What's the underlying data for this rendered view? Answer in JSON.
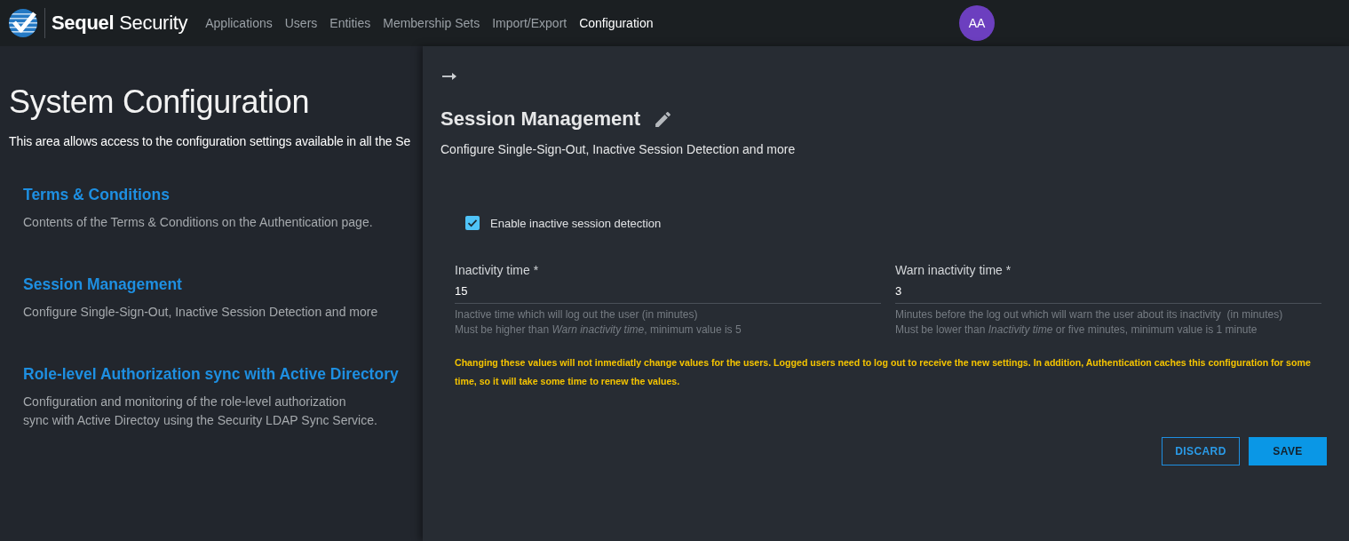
{
  "header": {
    "brand": "**Sequel** Security",
    "nav": [
      {
        "label": "Applications",
        "selected": false
      },
      {
        "label": "Users",
        "selected": false
      },
      {
        "label": "Entities",
        "selected": false
      },
      {
        "label": "Membership Sets",
        "selected": false
      },
      {
        "label": "Import/Export",
        "selected": false
      },
      {
        "label": "Configuration",
        "selected": true
      }
    ],
    "avatar": {
      "initials": "AA"
    }
  },
  "page": {
    "title": "System Configuration",
    "description": "This area allows access to the configuration settings available in all the Se",
    "sections": [
      {
        "title": "Terms & Conditions",
        "description": "Contents of the Terms & Conditions on the Authentication page."
      },
      {
        "title": "Session Management",
        "description": "Configure Single-Sign-Out, Inactive Session Detection and more"
      },
      {
        "title": "Role-level Authorization sync with Active Directory",
        "description": "Configuration and monitoring of the role-level authorization\nsync with Active Directoy using the Security LDAP Sync Service."
      }
    ]
  },
  "panel": {
    "title": "Session Management",
    "description": "Configure Single-Sign-Out, Inactive Session Detection and more",
    "checkbox": {
      "label": "Enable inactive session detection",
      "checked": true
    },
    "fields": [
      {
        "label": "Inactivity time *",
        "value": "15",
        "hints": [
          "Inactive time which will log out the user (in minutes)",
          "Must be higher than *Warn inactivity time*, minimum value is 5"
        ]
      },
      {
        "label": "Warn inactivity time *",
        "value": "3",
        "hints": [
          "Minutes before the log out which will warn the user about its inactivity  (in minutes)",
          "Must be lower than *Inactivity time* or five minutes, minimum value is 1 minute"
        ]
      }
    ],
    "warning": "Changing these values will not inmediatly change values for the users. Logged users need to log out to receive the new settings. In addition, Authentication caches this configuration for some time, so it will take some time to renew the values.",
    "buttons": [
      {
        "label": "DISCARD",
        "kind": "outlined"
      },
      {
        "label": "SAVE",
        "kind": "filled"
      }
    ]
  }
}
